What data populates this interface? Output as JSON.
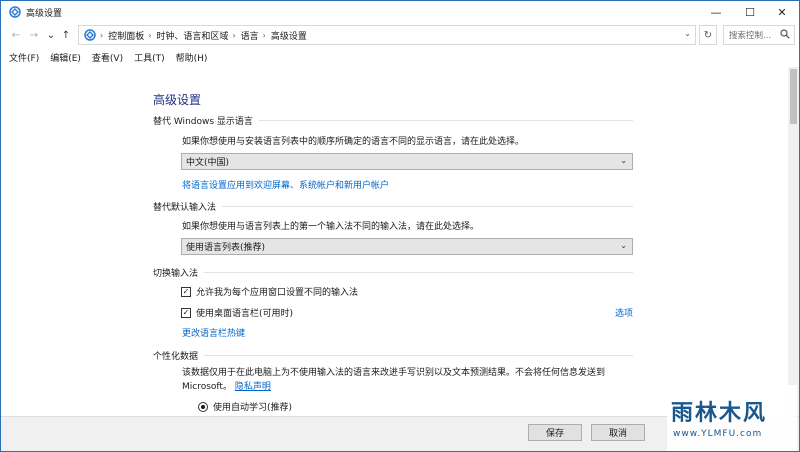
{
  "window": {
    "title": "高级设置",
    "minimize": "—",
    "maximize": "☐",
    "close": "✕"
  },
  "nav": {
    "back": "←",
    "forward": "→",
    "recent": "⌄",
    "up": "↑"
  },
  "address": {
    "segments": [
      "控制面板",
      "时钟、语言和区域",
      "语言",
      "高级设置"
    ],
    "separator": "›",
    "dropdown": "⌄",
    "refresh": "↻"
  },
  "search": {
    "placeholder": "搜索控制...",
    "icon": "search-icon"
  },
  "menu": [
    "文件(F)",
    "编辑(E)",
    "查看(V)",
    "工具(T)",
    "帮助(H)"
  ],
  "page": {
    "title": "高级设置",
    "display_lang": {
      "header": "替代 Windows 显示语言",
      "desc": "如果你想使用与安装语言列表中的顺序所确定的语言不同的显示语言，请在此处选择。",
      "selected": "中文(中国)",
      "link": "将语言设置应用到欢迎屏幕、系统帐户和新用户帐户"
    },
    "input_method": {
      "header": "替代默认输入法",
      "desc": "如果你想使用与语言列表上的第一个输入法不同的输入法，请在此处选择。",
      "selected": "使用语言列表(推荐)"
    },
    "switch_input": {
      "header": "切换输入法",
      "cb1": "允许我为每个应用窗口设置不同的输入法",
      "cb2": "使用桌面语言栏(可用时)",
      "options_link": "选项",
      "hotkeys_link": "更改语言栏热键"
    },
    "personalization": {
      "header": "个性化数据",
      "desc": "该数据仅用于在此电脑上为不使用输入法的语言来改进手写识别以及文本预测结果。不会将任何信息发送到",
      "desc2": "Microsoft。",
      "privacy_link": "隐私声明",
      "radio1": "使用自动学习(推荐)"
    }
  },
  "footer": {
    "save": "保存",
    "cancel": "取消"
  },
  "watermark": {
    "title": "雨林木风",
    "url": "www.YLMFU.com"
  },
  "colors": {
    "title_blue": "#1e3287",
    "link_blue": "#0066cc",
    "window_border": "#2b6fb6"
  }
}
